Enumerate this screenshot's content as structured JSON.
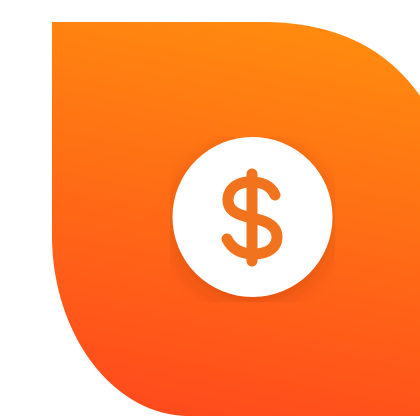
{
  "logo": {
    "icon": "dollar-coin-icon",
    "symbol": "$",
    "colors": {
      "gradient_top": "#FF8A0F",
      "gradient_bottom": "#FF4B1C",
      "coin_fill": "#FFFFFF",
      "symbol_color": "#F1731D",
      "background": "#FFFFFF"
    }
  }
}
